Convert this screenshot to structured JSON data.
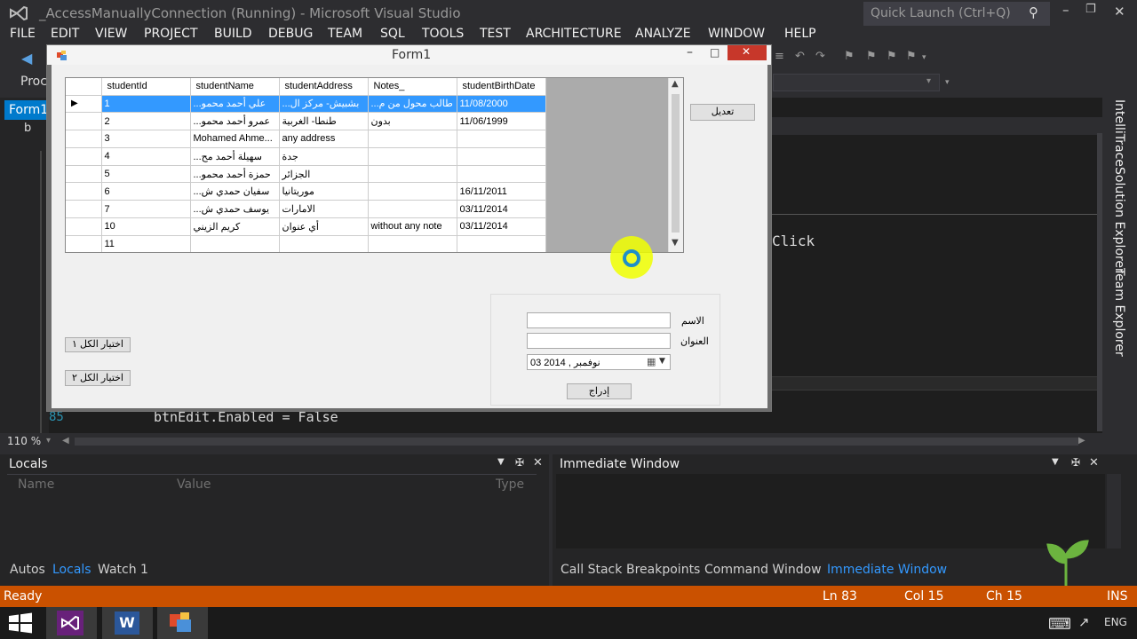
{
  "app": {
    "title": "_AccessManuallyConnection (Running) - Microsoft Visual Studio",
    "quick_launch": "Quick Launch (Ctrl+Q)"
  },
  "menu": [
    "FILE",
    "EDIT",
    "VIEW",
    "PROJECT",
    "BUILD",
    "DEBUG",
    "TEAM",
    "SQL",
    "TOOLS",
    "TEST",
    "ARCHITECTURE",
    "ANALYZE",
    "WINDOW",
    "HELP"
  ],
  "toolbar": {
    "proc_label": "Proc",
    "doc_tab": "Form1",
    "sub_item": "b"
  },
  "editor": {
    "click_text": "Click",
    "line_number": "85",
    "code_line": "btnEdit.Enabled = False",
    "zoom": "110 %"
  },
  "side_tabs": [
    "IntelliTrace",
    "Solution Explorer",
    "Team Explorer"
  ],
  "form": {
    "title": "Form1",
    "grid": {
      "columns": [
        "studentId",
        "studentName",
        "studentAddress",
        "Notes_",
        "studentBirthDate"
      ],
      "rows": [
        [
          "1",
          "...علي أحمد محمو",
          "...بشبيش- مركز ال",
          "...طالب محول من م",
          "11/08/2000"
        ],
        [
          "2",
          "...عمرو أحمد محمو",
          "طنطا- الغربية",
          "بدون",
          "11/06/1999"
        ],
        [
          "3",
          "Mohamed Ahme...",
          "any address",
          "",
          ""
        ],
        [
          "4",
          "...سهيلة أحمد مح",
          "جدة",
          "",
          ""
        ],
        [
          "5",
          "...حمزة أحمد محمو",
          "الجزائر",
          "",
          ""
        ],
        [
          "6",
          "...سفيان حمدي ش",
          "موريتانيا",
          "",
          "16/11/2011"
        ],
        [
          "7",
          "...يوسف حمدي ش",
          "الامارات",
          "",
          "03/11/2014"
        ],
        [
          "10",
          "كريم الزيني",
          "أي عنوان",
          "without any note",
          "03/11/2014"
        ],
        [
          "11",
          "",
          "",
          "",
          ""
        ]
      ]
    },
    "edit_button": "تعديل",
    "select_all_1": "اختيار الكل ١",
    "select_all_2": "اختيار الكل ٢",
    "name_label": "الاسم",
    "address_label": "العنوان",
    "date_value": "03   نوفمبر , 2014",
    "insert_button": "إدراج"
  },
  "locals": {
    "title": "Locals",
    "columns": [
      "Name",
      "Value",
      "Type"
    ],
    "tabs": [
      "Autos",
      "Locals",
      "Watch 1"
    ]
  },
  "immediate": {
    "title": "Immediate Window",
    "tabs": [
      "Call Stack",
      "Breakpoints",
      "Command Window",
      "Immediate Window"
    ]
  },
  "status": {
    "ready": "Ready",
    "ln": "Ln 83",
    "col": "Col 15",
    "ch": "Ch 15",
    "ins": "INS"
  },
  "taskbar": {
    "lang": "ENG"
  },
  "colors": {
    "accent": "#ca5100",
    "selection": "#3399ff",
    "highlight": "#f0ff00"
  }
}
